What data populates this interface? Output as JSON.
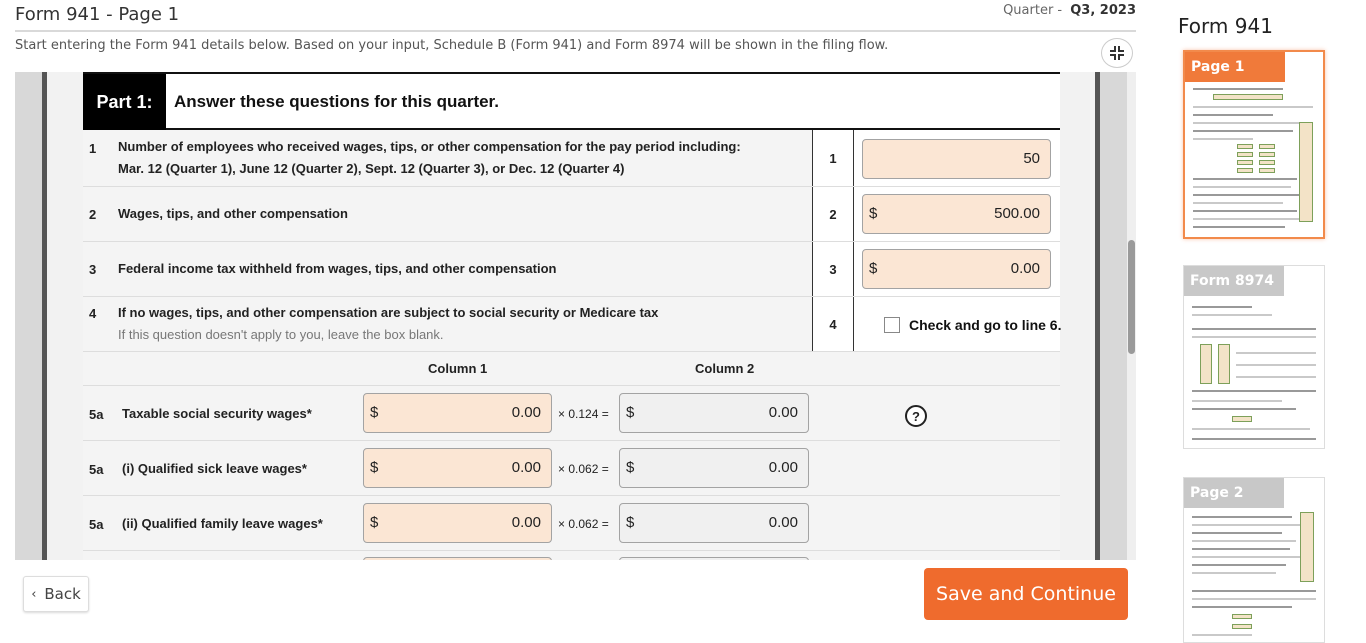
{
  "header": {
    "title": "Form 941 - Page 1",
    "quarter_label": "Quarter -",
    "quarter_value": "Q3, 2023",
    "subtitle": "Start entering the Form 941 details below. Based on your input, Schedule B (Form 941) and Form 8974 will be shown in the filing flow."
  },
  "form": {
    "part_label": "Part 1:",
    "part_title": "Answer these questions for this quarter.",
    "rows": [
      {
        "num": "1",
        "label": "Number of employees who received wages, tips, or other compensation for the pay period including:",
        "label2": "Mar. 12 (Quarter 1), June 12 (Quarter 2), Sept. 12 (Quarter 3), or Dec. 12 (Quarter 4)",
        "line": "1",
        "value": "50"
      },
      {
        "num": "2",
        "label": "Wages, tips, and other compensation",
        "line": "2",
        "currency": "$",
        "value": "500.00"
      },
      {
        "num": "3",
        "label": "Federal income tax withheld from wages, tips, and other compensation",
        "line": "3",
        "currency": "$",
        "value": "0.00"
      },
      {
        "num": "4",
        "label": "If no wages, tips, and other compensation are subject to social security or Medicare tax",
        "hint": "If this question doesn't apply to you, leave the box blank.",
        "line": "4",
        "checkbox_label": "Check and go to line 6.",
        "checked": false
      }
    ],
    "column1_header": "Column 1",
    "column2_header": "Column 2",
    "line5_rows": [
      {
        "num": "5a",
        "label": "Taxable social security wages*",
        "currency": "$",
        "col1": "0.00",
        "multiplier": "× 0.124 =",
        "col2": "0.00"
      },
      {
        "num": "5a",
        "label": "(i) Qualified sick leave wages*",
        "currency": "$",
        "col1": "0.00",
        "multiplier": "× 0.062 =",
        "col2": "0.00"
      },
      {
        "num": "5a",
        "label": "(ii) Qualified family leave wages*",
        "currency": "$",
        "col1": "0.00",
        "multiplier": "× 0.062 =",
        "col2": "0.00"
      }
    ],
    "help_glyph": "?"
  },
  "buttons": {
    "back": "Back",
    "save": "Save and Continue"
  },
  "sidebar": {
    "title": "Form 941",
    "thumbnails": [
      {
        "label": "Page 1",
        "active": true
      },
      {
        "label": "Form 8974",
        "active": false
      },
      {
        "label": "Page 2",
        "active": false
      }
    ]
  },
  "colors": {
    "accent": "#ef6b2d",
    "input_fill": "#fbe6d4",
    "readonly_fill": "#f0f0f0"
  }
}
